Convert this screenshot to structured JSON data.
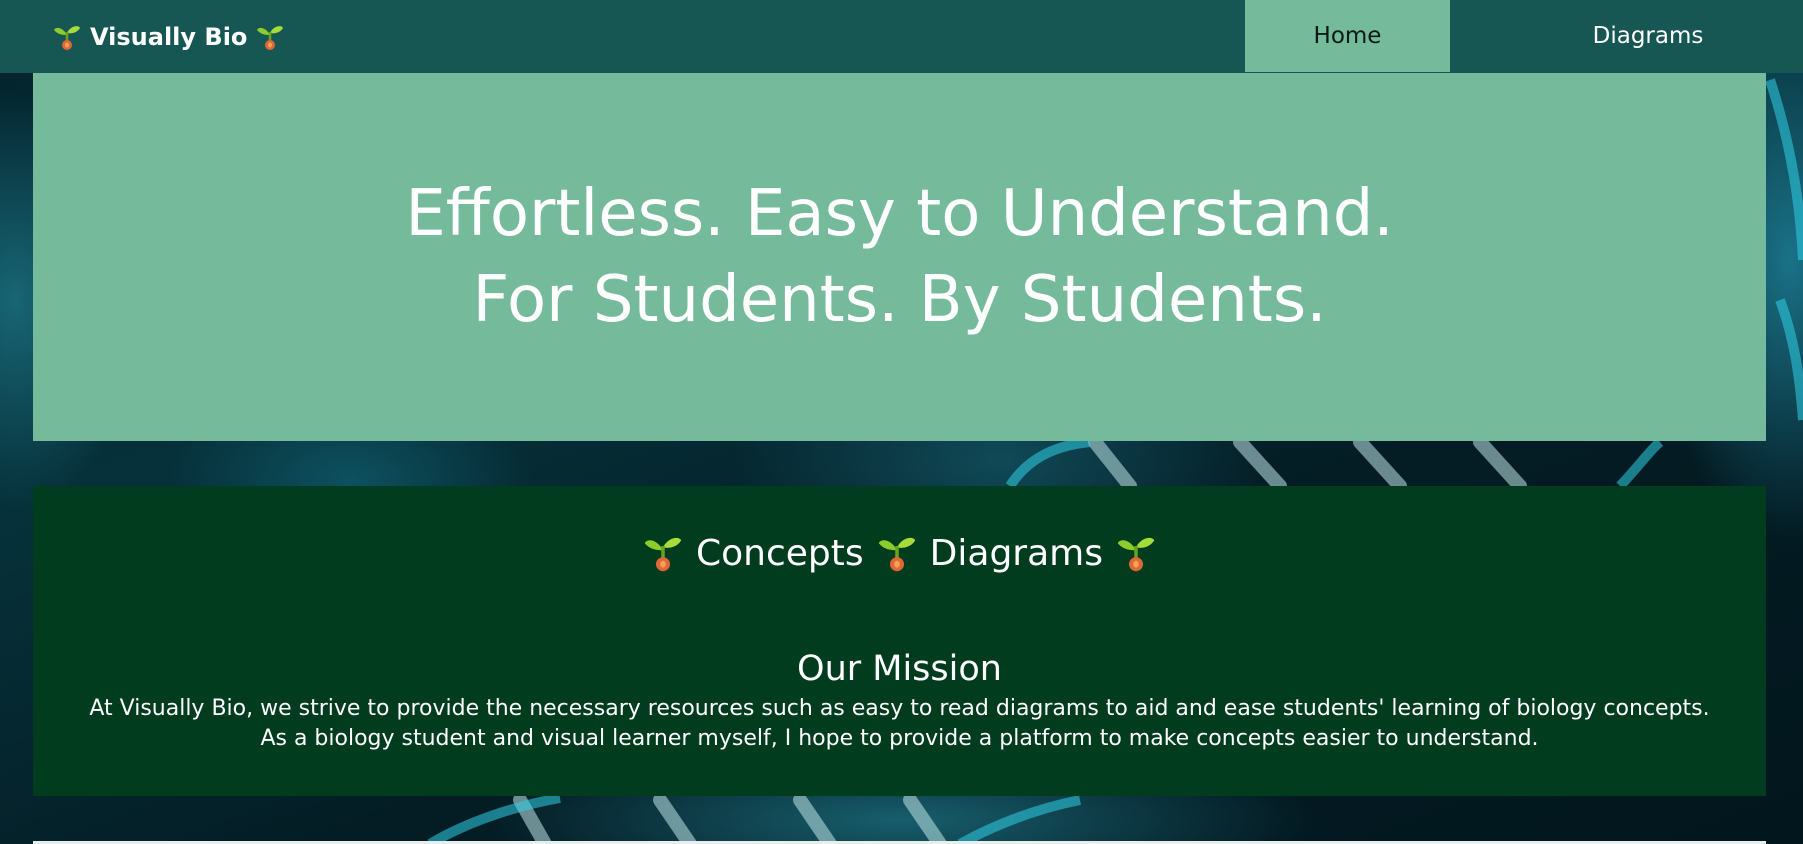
{
  "nav": {
    "brand": "Visually Bio",
    "items": [
      {
        "label": "Home",
        "active": true
      },
      {
        "label": "Diagrams",
        "active": false
      }
    ]
  },
  "hero": {
    "line1": "Effortless. Easy to Understand.",
    "line2": "For Students. By Students."
  },
  "mission": {
    "tagline_a": "Concepts",
    "tagline_b": "Diagrams",
    "heading": "Our Mission",
    "body_line1": "At Visually Bio, we strive to provide the necessary resources such as easy to read diagrams to aid and ease students' learning of biology concepts.",
    "body_line2": "As a biology student and visual learner myself, I hope to provide a platform to make concepts easier to understand."
  },
  "colors": {
    "nav_bg": "#175753",
    "hero_bg": "#74ba9b",
    "mission_bg": "#013c1e",
    "text_light": "#ffffff"
  },
  "icons": {
    "brand_icon": "sprout-icon"
  }
}
